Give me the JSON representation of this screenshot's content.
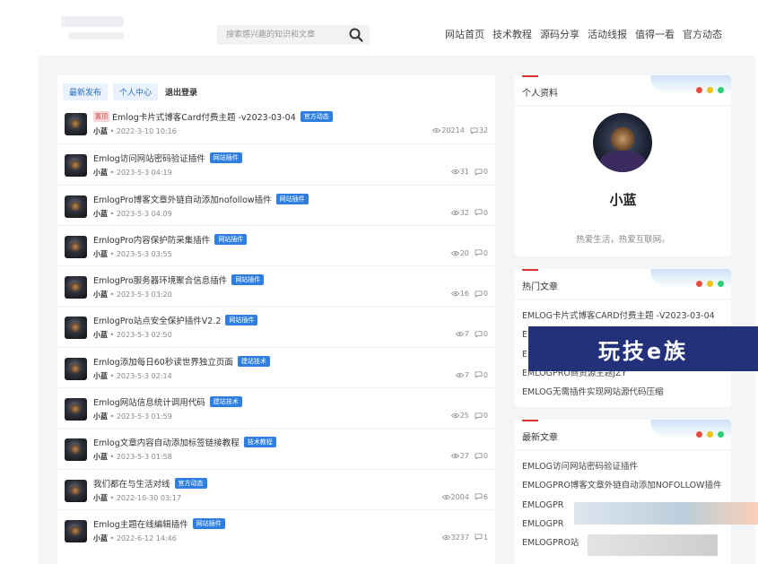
{
  "search": {
    "placeholder": "搜索感兴趣的知识和文章"
  },
  "nav": [
    "网站首页",
    "技术教程",
    "源码分享",
    "活动线报",
    "值得一看",
    "官方动态"
  ],
  "tabs": {
    "latest": "最新发布",
    "personal": "个人中心",
    "logout": "退出登录"
  },
  "posts": [
    {
      "pinned": "置顶",
      "title": "Emlog卡片式博客Card付费主题 -v2023-03-04",
      "badge": "官方动态",
      "author": "小蓝",
      "date": "2022-3-10 10:16",
      "views": "20214",
      "comments": "32"
    },
    {
      "title": "Emlog访问网站密码验证插件",
      "badge": "网站插件",
      "author": "小蓝",
      "date": "2023-5-3 04:19",
      "views": "31",
      "comments": "0"
    },
    {
      "title": "EmlogPro博客文章外链自动添加nofollow插件",
      "badge": "网站插件",
      "author": "小蓝",
      "date": "2023-5-3 04:09",
      "views": "32",
      "comments": "0"
    },
    {
      "title": "EmlogPro内容保护防采集插件",
      "badge": "网站插件",
      "author": "小蓝",
      "date": "2023-5-3 03:55",
      "views": "20",
      "comments": "0"
    },
    {
      "title": "EmlogPro服务器环境聚合信息插件",
      "badge": "网站插件",
      "author": "小蓝",
      "date": "2023-5-3 03:20",
      "views": "16",
      "comments": "0"
    },
    {
      "title": "EmlogPro站点安全保护插件V2.2",
      "badge": "网站插件",
      "author": "小蓝",
      "date": "2023-5-3 02:50",
      "views": "7",
      "comments": "0"
    },
    {
      "title": "Emlog添加每日60秒读世界独立页面",
      "badge": "建站技术",
      "author": "小蓝",
      "date": "2023-5-3 02:14",
      "views": "7",
      "comments": "0"
    },
    {
      "title": "Emlog网站信息统计调用代码",
      "badge": "建站技术",
      "author": "小蓝",
      "date": "2023-5-3 01:59",
      "views": "25",
      "comments": "0"
    },
    {
      "title": "Emlog文章内容自动添加标签链接教程",
      "badge": "技术教程",
      "author": "小蓝",
      "date": "2023-5-3 01:58",
      "views": "27",
      "comments": "0"
    },
    {
      "title": "我们都在与生活对线",
      "badge": "官方动态",
      "author": "小蓝",
      "date": "2022-10-30 03:17",
      "views": "2004",
      "comments": "6"
    },
    {
      "title": "Emlog主题在线编辑插件",
      "badge": "网站插件",
      "author": "小蓝",
      "date": "2022-6-12 14:46",
      "views": "3237",
      "comments": "1"
    }
  ],
  "profile": {
    "title": "个人资料",
    "name": "小蓝",
    "bio": "热爱生活，热爱互联网。"
  },
  "hot": {
    "title": "热门文章",
    "items": [
      "EMLOG卡片式博客CARD付费主题 -V2023-03-04",
      "E",
      "E",
      "EMLOGPRO商资源主题JZY",
      "EMLOG无需插件实现网站源代码压缩"
    ]
  },
  "latest": {
    "title": "最新文章",
    "items": [
      "EMLOG访问网站密码验证插件",
      "EMLOGPRO博客文章外链自动添加NOFOLLOW插件",
      "EMLOGPR",
      "EMLOGPR",
      "EMLOGPRO站"
    ]
  },
  "overlay": {
    "brand": "玩技e族"
  },
  "colors": {
    "accent": "#2f7fe0",
    "dot_red": "#e74c3c",
    "dot_yellow": "#f1c40f",
    "dot_green": "#2ecc71",
    "overlay_bg": "#23317a"
  },
  "icons": {
    "search": "search-icon",
    "views": "eye-icon",
    "comments": "comment-icon"
  }
}
